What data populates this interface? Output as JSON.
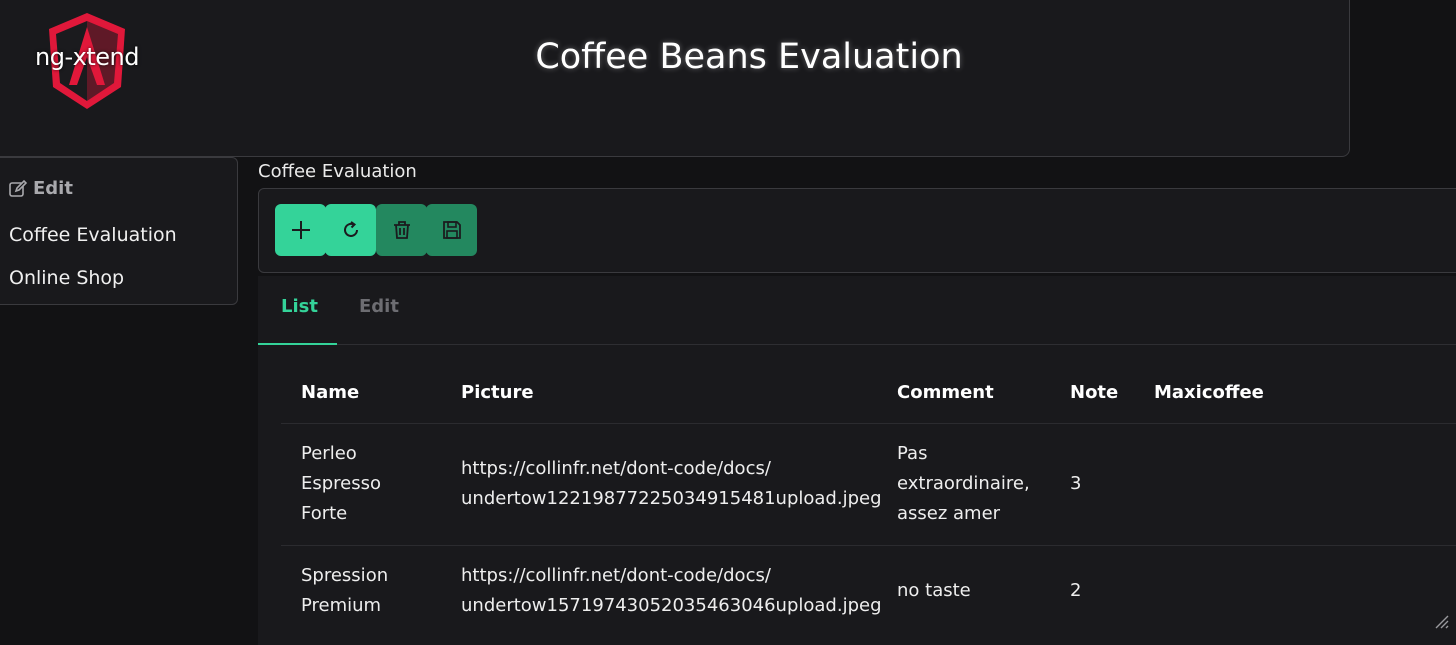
{
  "header": {
    "logo_text": "ng-xtend",
    "title": "Coffee Beans Evaluation"
  },
  "sidebar": {
    "heading": "Edit",
    "items": [
      {
        "label": "Coffee Evaluation"
      },
      {
        "label": "Online Shop"
      }
    ]
  },
  "main": {
    "section_title": "Coffee Evaluation",
    "toolbar": [
      {
        "icon": "plus-icon",
        "name": "add-button"
      },
      {
        "icon": "refresh-icon",
        "name": "reload-button"
      },
      {
        "icon": "trash-icon",
        "name": "delete-button"
      },
      {
        "icon": "save-icon",
        "name": "save-button"
      }
    ],
    "tabs": [
      {
        "label": "List",
        "active": true
      },
      {
        "label": "Edit",
        "active": false
      }
    ],
    "table": {
      "columns": [
        "Name",
        "Picture",
        "Comment",
        "Note",
        "Maxicoffee"
      ],
      "rows": [
        {
          "name": [
            "Perleo",
            "Espresso",
            "Forte"
          ],
          "picture": [
            "https://collinfr.net/dont-code/docs/",
            "undertow1221987722503491548​1upload.jpeg"
          ],
          "comment": [
            "Pas",
            "extraordinaire,",
            "assez amer"
          ],
          "note": "3",
          "maxicoffee": ""
        },
        {
          "name": [
            "Spression",
            "Premium"
          ],
          "picture": [
            "https://collinfr.net/dont-code/docs/",
            "undertow1571974305203546304​6upload.jpeg"
          ],
          "comment": [
            "no taste"
          ],
          "note": "2",
          "maxicoffee": ""
        }
      ]
    }
  },
  "colors": {
    "accent": "#34d399",
    "accent_dim": "#23885f",
    "logo_red": "#e0183a"
  }
}
